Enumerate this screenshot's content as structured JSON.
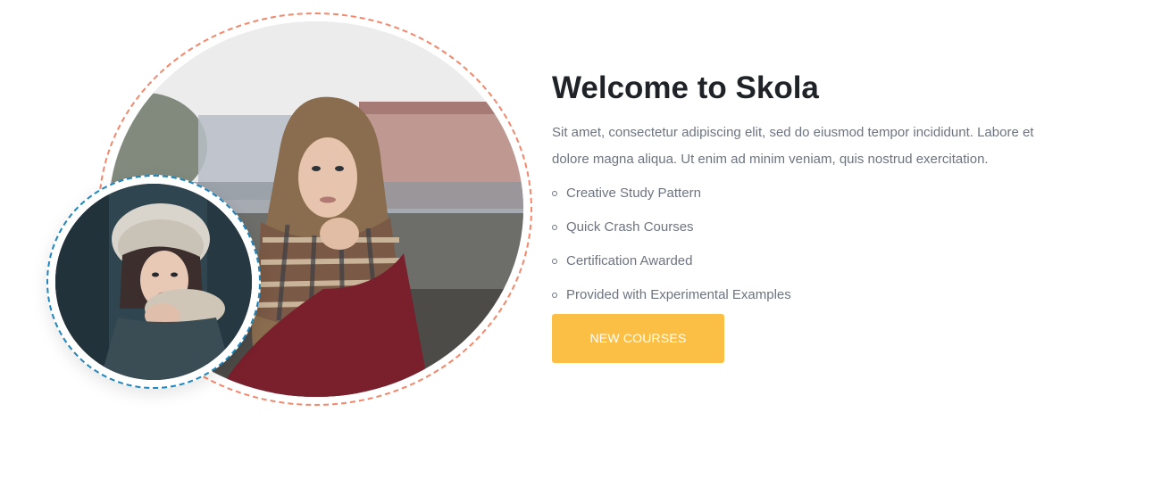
{
  "about": {
    "title": "Welcome to Skola",
    "description": "Sit amet, consectetur adipiscing elit, sed do eiusmod tempor incididunt. Labore et dolore magna aliqua. Ut enim ad minim veniam, quis nostrud exercitation.",
    "features": [
      "Creative Study Pattern",
      "Quick Crash Courses",
      "Certification Awarded",
      "Provided with Experimental Examples"
    ],
    "cta_label": "NEW COURSES"
  },
  "colors": {
    "accent_button": "#fbbf45",
    "big_ring_dashed": "#f3876b",
    "small_ring_dashed": "#1f86bd",
    "title_text": "#1f2327",
    "body_text": "#6d7480"
  }
}
